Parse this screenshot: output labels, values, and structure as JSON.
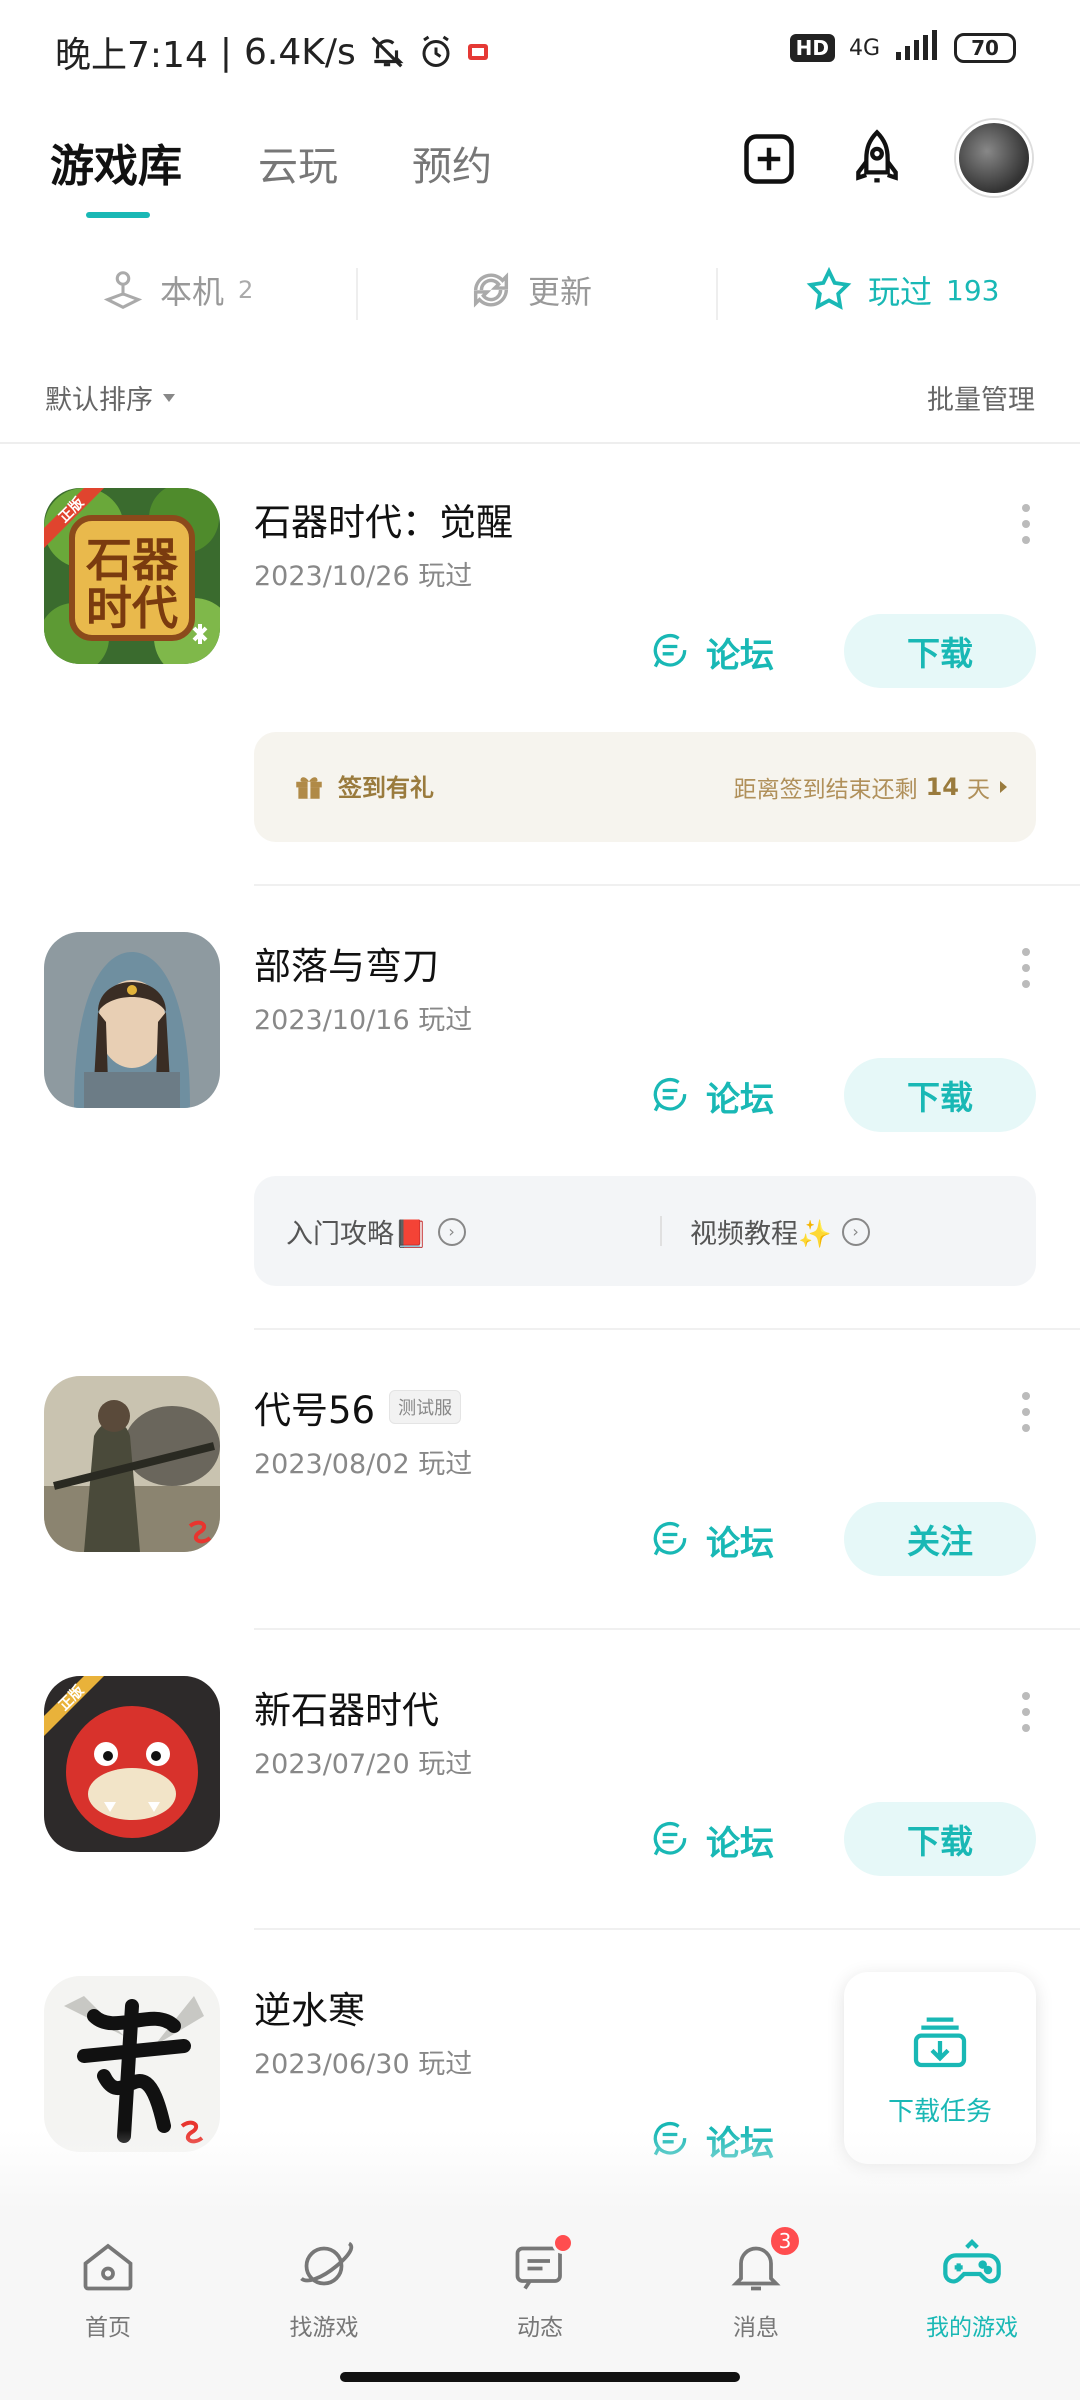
{
  "status_bar": {
    "time": "晚上7:14",
    "net_speed": "6.4K/s",
    "hd": "HD",
    "network": "4G",
    "battery": "70"
  },
  "header": {
    "tabs": [
      "游戏库",
      "云玩",
      "预约"
    ]
  },
  "filters": {
    "local": {
      "label": "本机",
      "count": "2"
    },
    "update": {
      "label": "更新"
    },
    "played": {
      "label": "玩过",
      "count": "193"
    }
  },
  "sort": {
    "label": "默认排序",
    "manage": "批量管理"
  },
  "games": [
    {
      "title": "石器时代：觉醒",
      "date": "2023/10/26 玩过",
      "forum": "论坛",
      "action": "下载"
    },
    {
      "title": "部落与弯刀",
      "date": "2023/10/16 玩过",
      "forum": "论坛",
      "action": "下载"
    },
    {
      "title": "代号56",
      "badge": "测试服",
      "date": "2023/08/02 玩过",
      "forum": "论坛",
      "action": "关注"
    },
    {
      "title": "新石器时代",
      "date": "2023/07/20 玩过",
      "forum": "论坛",
      "action": "下载"
    },
    {
      "title": "逆水寒",
      "date": "2023/06/30 玩过",
      "forum": "论坛"
    }
  ],
  "signin_card": {
    "label": "签到有礼",
    "remain_prefix": "距离签到结束还剩",
    "days": "14",
    "days_unit": "天"
  },
  "guide_card": {
    "guide": "入门攻略📕",
    "video": "视频教程✨"
  },
  "download_task": {
    "label": "下载任务"
  },
  "bottom_nav": {
    "items": [
      "首页",
      "找游戏",
      "动态",
      "消息",
      "我的游戏"
    ],
    "message_badge": "3"
  },
  "colors": {
    "accent": "#19b8b5",
    "gold": "#9a7b3d",
    "badge": "#ff4d4f"
  }
}
